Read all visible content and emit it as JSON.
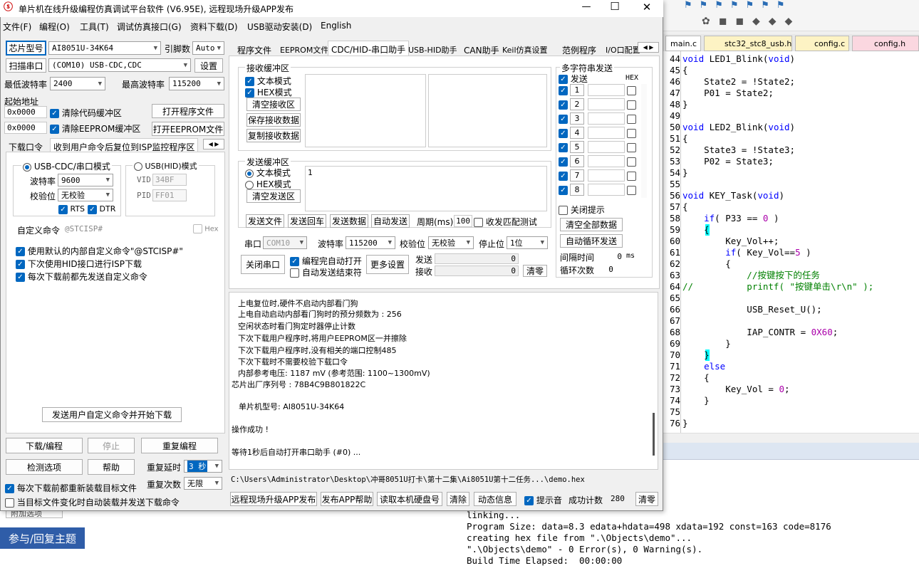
{
  "window": {
    "title": "单片机在线升级编程仿真调试平台软件 (V6.95E), 远程现场升级APP发布",
    "min": "—",
    "max": "☐",
    "close": "✕"
  },
  "menu": [
    "文件(F)",
    "编程(O)",
    "工具(T)",
    "调试仿真接口(G)",
    "资料下载(D)",
    "USB驱动安装(D)",
    "English"
  ],
  "left": {
    "chip_btn": "芯片型号",
    "chip_val": "AI8051U-34K64",
    "pin_lbl": "引脚数",
    "pin_val": "Auto",
    "scan_btn": "扫描串口",
    "port_val": "(COM10) USB-CDC,CDC",
    "set_btn": "设置",
    "min_baud_lbl": "最低波特率",
    "min_baud": "2400",
    "max_baud_lbl": "最高波特率",
    "max_baud": "115200",
    "start_addr": "起始地址",
    "addr1": "0x0000",
    "clr_code": "清除代码缓冲区",
    "open_prog": "打开程序文件",
    "addr2": "0x0000",
    "clr_eeprom": "清除EEPROM缓冲区",
    "open_eeprom": "打开EEPROM文件",
    "tab1": "下载口令",
    "tab2": "收到用户命令后复位到ISP监控程序区",
    "mode1": "USB-CDC/串口模式",
    "mode2": "USB(HID)模式",
    "baud_lbl": "波特率",
    "baud_val": "9600",
    "parity_lbl": "校验位",
    "parity_val": "无校验",
    "rts": "RTS",
    "dtr": "DTR",
    "vid_lbl": "VID",
    "vid_val": "34BF",
    "pid_lbl": "PID",
    "pid_val": "FF01",
    "custom_lbl": "自定义命令",
    "custom_val": "@STCISP#",
    "hex": "Hex",
    "opt1": "使用默认的内部自定义命令\"@STCISP#\"",
    "opt2": "下次使用HID接口进行ISP下载",
    "opt3": "每次下载前都先发送自定义命令",
    "send_dl_btn": "发送用户自定义命令并开始下载",
    "dl_btn": "下载/编程",
    "stop_btn": "停止",
    "reprog_btn": "重复编程",
    "check_btn": "检测选项",
    "help_btn": "帮助",
    "delay_lbl": "重复延时",
    "delay_val": "3 秒",
    "reload_lbl": "每次下载前都重新装载目标文件",
    "count_lbl": "重复次数",
    "count_val": "无限",
    "auto_lbl": "当目标文件变化时自动装载并发送下载命令"
  },
  "tabs": [
    "程序文件",
    "EEPROM文件",
    "CDC/HID-串口助手",
    "USB-HID助手",
    "CAN助手",
    "Keil仿真设置",
    "范例程序",
    "I/O口配置"
  ],
  "serial": {
    "rx_title": "接收缓冲区",
    "text_mode": "文本模式",
    "hex_mode": "HEX模式",
    "clr_rx": "清空接收区",
    "save_rx": "保存接收数据",
    "copy_rx": "复制接收数据",
    "tx_title": "发送缓冲区",
    "tx_text": "文本模式",
    "tx_hex": "HEX模式",
    "clr_tx": "清空发送区",
    "tx_content": "1",
    "send_file": "发送文件",
    "send_cr": "发送回车",
    "send_data": "发送数据",
    "auto_send": "自动发送",
    "period_lbl": "周期(ms)",
    "period_val": "100",
    "match": "收发匹配测试",
    "port_lbl": "串口",
    "port_val": "COM10",
    "baud_lbl": "波特率",
    "baud_val": "115200",
    "parity_lbl": "校验位",
    "parity_val": "无校验",
    "stop_lbl": "停止位",
    "stop_val": "1位",
    "close_btn": "关闭串口",
    "auto_open": "编程完自动打开",
    "auto_stop": "自动发送结束符",
    "more_btn": "更多设置",
    "send_lbl": "发送",
    "send_val": "0",
    "recv_lbl": "接收",
    "recv_val": "0",
    "clear_btn": "清零"
  },
  "multi": {
    "title": "多字符串发送",
    "send": "发送",
    "hex": "HEX",
    "rows": [
      "1",
      "2",
      "3",
      "4",
      "5",
      "6",
      "7",
      "8"
    ],
    "close_tip": "关闭提示",
    "clear_all": "清空全部数据",
    "auto_loop": "自动循环发送",
    "interval_lbl": "间隔时间",
    "interval_val": "0",
    "ms": "ms",
    "loop_lbl": "循环次数",
    "loop_val": "0"
  },
  "log": [
    "上电复位时,硬件不启动内部看门狗",
    "上电自动启动内部看门狗时的预分频数为 : 256",
    "空闲状态时看门狗定时器停止计数",
    "下次下载用户程序时,将用户EEPROM区一并擦除",
    "下次下载用户程序时,没有相关的端口控制485",
    "下次下载时不需要校验下载口令",
    "内部参考电压: 1187 mV (参考范围: 1100~1300mV)",
    "芯片出厂序列号 : 78B4C9B801822C",
    "单片机型号: AI8051U-34K64",
    "操作成功 !",
    "等待1秒后自动打开串口助手 (#0) ..."
  ],
  "path": "C:\\Users\\Administrator\\Desktop\\冲哥8051U打卡\\第十二集\\Ai8051U第十二任务...\\demo.hex",
  "bottom": {
    "remote_btn": "远程现场升级APP发布",
    "app_help": "发布APP帮助",
    "read_disk": "读取本机硬盘号",
    "clear_btn": "清除",
    "dyn_btn": "动态信息",
    "beep": "提示音",
    "success_lbl": "成功计数",
    "success_val": "280",
    "zero_btn": "清零"
  },
  "editor": {
    "tabs": [
      "main.c",
      "stc32_stc8_usb.h",
      "config.c",
      "config.h"
    ],
    "lines": [
      {
        "n": "44",
        "t": "void LED1_Blink(void)"
      },
      {
        "n": "45",
        "t": "{"
      },
      {
        "n": "46",
        "t": "    State2 = !State2;"
      },
      {
        "n": "47",
        "t": "    P01 = State2;"
      },
      {
        "n": "48",
        "t": "}"
      },
      {
        "n": "49",
        "t": ""
      },
      {
        "n": "50",
        "t": "void LED2_Blink(void)"
      },
      {
        "n": "51",
        "t": "{"
      },
      {
        "n": "52",
        "t": "    State3 = !State3;"
      },
      {
        "n": "53",
        "t": "    P02 = State3;"
      },
      {
        "n": "54",
        "t": "}"
      },
      {
        "n": "55",
        "t": ""
      },
      {
        "n": "56",
        "t": "void KEY_Task(void)"
      },
      {
        "n": "57",
        "t": "{"
      },
      {
        "n": "58",
        "t": "    if( P33 == 0 )"
      },
      {
        "n": "59",
        "t": "    {"
      },
      {
        "n": "60",
        "t": "        Key_Vol++;"
      },
      {
        "n": "61",
        "t": "        if( Key_Vol==5 )"
      },
      {
        "n": "62",
        "t": "        {"
      },
      {
        "n": "63",
        "t": "            //按键按下的任务"
      },
      {
        "n": "64",
        "t": "//          printf( \"按键单击\\r\\n\" );"
      },
      {
        "n": "65",
        "t": ""
      },
      {
        "n": "66",
        "t": "            USB_Reset_U();"
      },
      {
        "n": "67",
        "t": ""
      },
      {
        "n": "68",
        "t": "            IAP_CONTR = 0X60;"
      },
      {
        "n": "69",
        "t": "        }"
      },
      {
        "n": "70",
        "t": "    }"
      },
      {
        "n": "71",
        "t": "    else"
      },
      {
        "n": "72",
        "t": "    {"
      },
      {
        "n": "73",
        "t": "        Key_Vol = 0;"
      },
      {
        "n": "74",
        "t": "    }"
      },
      {
        "n": "75",
        "t": ""
      },
      {
        "n": "76",
        "t": "}"
      }
    ]
  },
  "build_output": [
    "linking...",
    "Program Size: data=8.3 edata+hdata=498 xdata=192 const=163 code=8176",
    "creating hex file from \".\\Objects\\demo\"...",
    "\".\\Objects\\demo\" - 0 Error(s), 0 Warning(s).",
    "Build Time Elapsed:  00:00:00"
  ],
  "forum": {
    "reply_btn": "参与/回复主题",
    "attach": "附加选项"
  },
  "colors": {
    "accent": "#0067c0",
    "keyword": "#0000ff",
    "comment": "#008000",
    "brand": "#2f5da8"
  }
}
